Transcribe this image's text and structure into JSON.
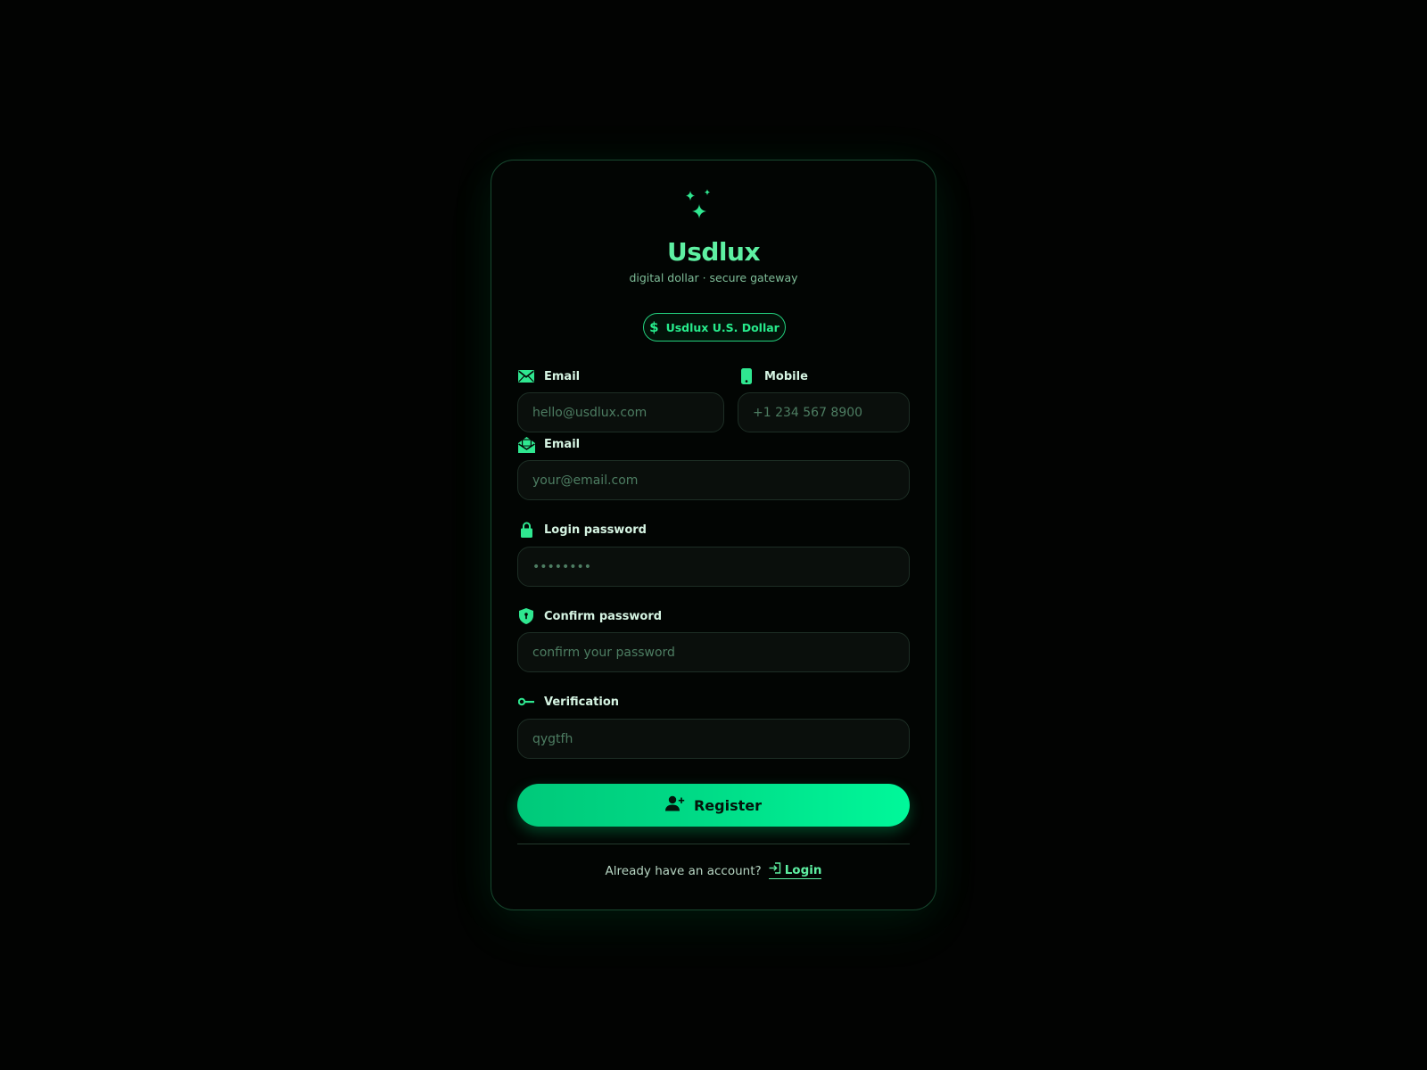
{
  "brand": {
    "name": "Usdlux",
    "tagline": "digital dollar · secure gateway",
    "badge": "Usdlux U.S. Dollar",
    "badge_icon": "dollar-icon",
    "logo_icon": "sparkles-icon"
  },
  "form": {
    "email_top": {
      "label": "Email",
      "placeholder": "hello@usdlux.com",
      "icon": "envelope-icon"
    },
    "mobile": {
      "label": "Mobile",
      "placeholder": "+1 234 567 8900",
      "icon": "mobile-phone-icon"
    },
    "email": {
      "label": "Email",
      "placeholder": "your@email.com",
      "icon": "envelope-open-icon"
    },
    "password": {
      "label": "Login password",
      "value": "••••••••",
      "icon": "lock-icon"
    },
    "confirm": {
      "label": "Confirm password",
      "placeholder": "confirm your password",
      "icon": "shield-icon"
    },
    "verification": {
      "label": "Verification",
      "placeholder": "qygtfh",
      "icon": "key-icon"
    },
    "register_label": "Register",
    "register_icon": "user-plus-icon"
  },
  "footer": {
    "prompt": "Already have an account?",
    "login_label": "Login",
    "login_icon": "sign-in-icon"
  },
  "colors": {
    "background": "#020302",
    "accent": "#00e68a",
    "brand_text": "#5ef0a2",
    "card_border": "#17492f"
  }
}
